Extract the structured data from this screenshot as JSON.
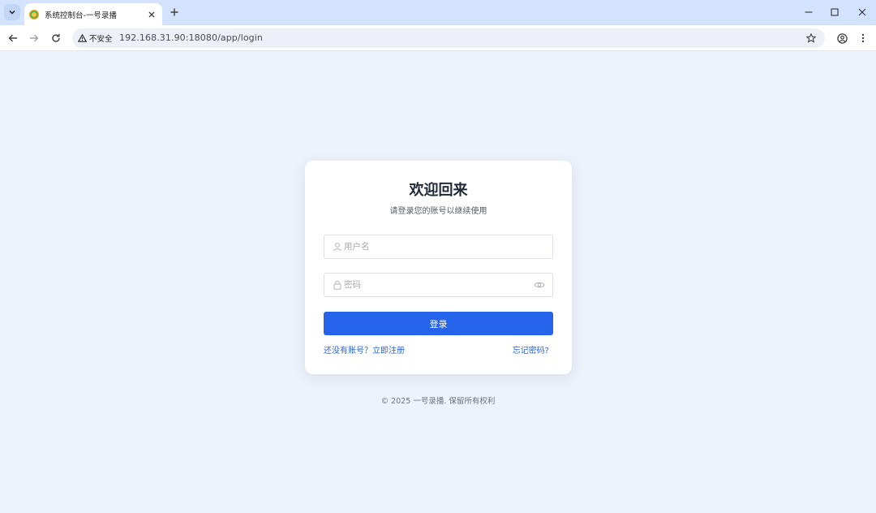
{
  "browser": {
    "tab": {
      "title": "系统控制台-一号录播"
    },
    "security_label": "不安全",
    "url": "192.168.31.90:18080/app/login"
  },
  "login": {
    "title": "欢迎回来",
    "subtitle": "请登录您的账号以继续使用",
    "username_placeholder": "用户名",
    "password_placeholder": "密码",
    "login_button": "登录",
    "register_link": "还没有账号？立即注册",
    "forgot_link": "忘记密码?"
  },
  "footer": {
    "copyright": "© 2025 一号录播. 保留所有权利"
  },
  "colors": {
    "accent": "#2563eb",
    "page_bg": "#eef2fb",
    "tabstrip_bg": "#d3e3fd"
  }
}
